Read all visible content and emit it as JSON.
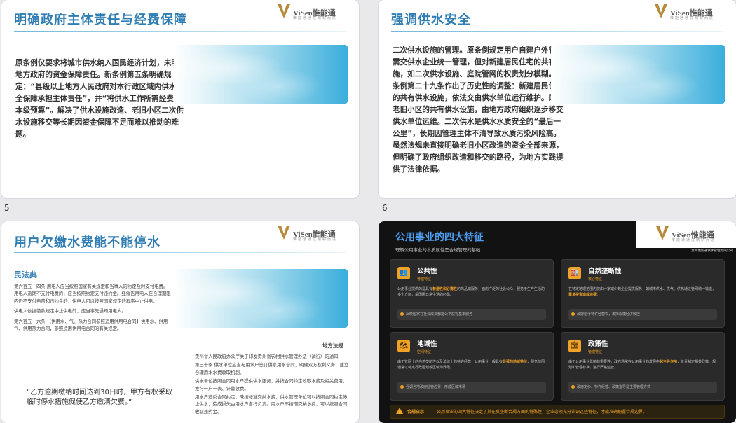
{
  "brand": {
    "name": "ViSen惟能通",
    "tagline": "惟能通通过精耕而进",
    "brand_color": "#b88a3c"
  },
  "slides": [
    {
      "num": "5",
      "title": "明确政府主体责任与经费保障",
      "body": "原条例仅要求将城市供水纳入国民经济计划，未明确地方政府的资金保障责任。新条例第五条明确规定：“县级以上地方人民政府对本行政区域内供水安全保障承担主体责任”，并“将供水工作所需经费列入本级预算”。解决了供水设施改造、老旧小区二次供水设施移交等长期因资金保障不足而难以推动的难题。"
    },
    {
      "num": "6",
      "title": "强调供水安全",
      "body": "二次供水设施的管理。原条例规定用户自建户外管道需交供水企业统一管理，但对新建居民住宅的共有设施，如二次供水设施、庭院管网的权责划分模糊。新条例第二十九条作出了历史性的调整：新建居民住宅的共有供水设施，依法交由供水单位运行维护。既有老旧小区的共有供水设施，由地方政府组织逐步移交供水单位运维。二次供水是供水水质安全的“最后一公里”，长期因管理主体不清导致水质污染风险高。虽然法规未直接明确老旧小区改造的资金全部来源，但明确了政府组织改造和移交的路径，为地方实践提供了法律依据。"
    },
    {
      "title": "用户欠缴水费能不能停水",
      "sub": "民法典",
      "law": [
        "第六百五十四条  用电人应当按照国家有关规定和当事人的约定及时支付电费。用电人逾期不支付电费的，应当按照约定支付违约金。经催告用电人在合理期限内仍不支付电费和违约金的，供电人可以按照国家规定的程序中止供电。",
        "供电人依据前款规定中止供电的，应当事先通知用电人。",
        "第六百五十六条 【供用水、气、热力合同参照适用供用电合同】供用水、供用气、供用热力合同，参照适用供用电合同的有关规定。"
      ],
      "local_title": "地方法规",
      "local": [
        "贵州省人民政府办公厅关于印发贵州省农村供水管理办法（试行）的通知",
        "第三十条   供水单位应当与用水户签订供水用水合同，明确双方权利义务，建立合理用水水费收取机制。",
        "供水单位按照合同用水户提供供水服务，并按合同约定收取水费及相关费用，推行一户一表、计量收费。",
        "用水户违反合同约定，未按标准交纳水费，供水管理单位可以按照合同约定停止供水，造成损失由用水户自行负责。用水户不按期交纳水费，可以按照合同收取违约金。"
      ],
      "quote": "“乙方逾期缴纳时间达到30日时，甲方有权采取临时停水措施促使乙方缴清欠费。”"
    },
    {
      "title": "公用事业的四大特征",
      "subtitle": "理解公用事业的本质属性是合规管理的基础",
      "brand_caption": "贵州惟能通供水管理有限公司",
      "cards": [
        {
          "icon": "people-icon",
          "glyph": "👥",
          "title": "公共性",
          "tag": "普遍特征",
          "desc_a": "公用事业提供的是具有",
          "desc_hl": "普遍性和必需性",
          "desc_b": "的商品或服务，面向广泛的社会公众，服务于生产生活的多个方面，是国民日常生活的必需。",
          "note": "反映国家在社会成员都能公平获得基本服务"
        },
        {
          "icon": "factory-icon",
          "glyph": "🏭",
          "title": "自然垄断性",
          "tag": "核心特征",
          "desc_a": "在特定地理范围内仅由一家或少数企业提供服务，如城市供水、供气、供热通过管网统一输送，",
          "desc_hl": "重复投资造成浪费",
          "desc_b": "。",
          "note": "政府给予特许经营权，发挥规模经济效应"
        },
        {
          "icon": "map-icon",
          "glyph": "🗺",
          "title": "地域性",
          "tag": "空间特征",
          "desc_a": "由于管网上的自然垄断性以及法律上的特许经营，公用事业一般具有",
          "desc_hl": "显著的地域特征",
          "desc_b": "，服务范围通常以特定行政区划或区域为界限。",
          "note": "强调当地政府监管边界，形成区域市场"
        },
        {
          "icon": "government-icon",
          "glyph": "🏛",
          "title": "政策性",
          "tag": "管理特征",
          "desc_a": "由于公用事业影响的重要性，政府通常在公用事业的发展中",
          "desc_hl": "起主导作用",
          "desc_b": "，负责制定相关政策、规划和管理标准，进行严格监管。",
          "note": "政府定价、特许经营、政策指导是主要管理方式"
        }
      ],
      "bottom_label": "合规启示：",
      "bottom_text": "公用事业的四大特征决定了其在反垄断合规方面的特殊性，企业必须充分认识这些特征，才能准确把握合规边界。",
      "accent": "#f0a326"
    }
  ]
}
